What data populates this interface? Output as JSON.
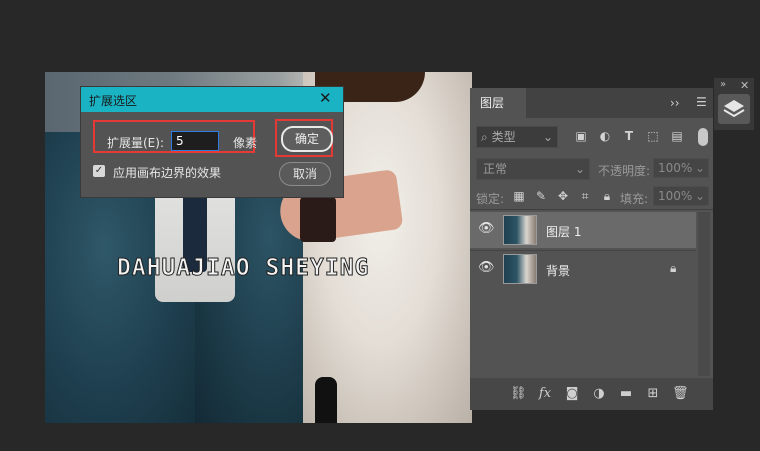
{
  "canvas": {
    "watermark_text": "DAHUAJIAO SHEYING"
  },
  "dialog": {
    "title": "扩展选区",
    "close_icon": "close-icon",
    "amount_label": "扩展量(E):",
    "amount_value": "5",
    "unit_label": "像素",
    "ok_label": "确定",
    "cancel_label": "取消",
    "checkbox_label": "应用画布边界的效果",
    "checkbox_checked": true,
    "accent_color": "#19b3c4",
    "highlight_color": "#e53935"
  },
  "layers_panel": {
    "tab_label": "图层",
    "collapse_icon": "double-chevron-right-icon",
    "menu_icon": "hamburger-menu-icon",
    "filter_kind_label": "类型",
    "filter_icons": [
      "image-filter-icon",
      "adjustment-filter-icon",
      "type-filter-icon",
      "shape-filter-icon",
      "smart-object-filter-icon"
    ],
    "blend_mode": "正常",
    "opacity_label": "不透明度:",
    "opacity_value": "100%",
    "lock_label": "锁定:",
    "lock_icons": [
      "lock-transparent-icon",
      "lock-pixels-icon",
      "lock-position-icon",
      "lock-artboard-icon",
      "lock-all-icon"
    ],
    "fill_label": "填充:",
    "fill_value": "100%",
    "layers": [
      {
        "name": "图层 1",
        "visible": true,
        "selected": true,
        "locked": false
      },
      {
        "name": "背景",
        "visible": true,
        "selected": false,
        "locked": true
      }
    ],
    "bottom_icons": [
      "link-layers-icon",
      "fx-icon",
      "add-mask-icon",
      "adjustment-layer-icon",
      "new-group-icon",
      "new-layer-icon",
      "delete-layer-icon"
    ]
  },
  "dock": {
    "expand_icon": "double-chevron-right-icon",
    "close_icon": "close-icon",
    "layers_icon": "layers-stack-icon"
  }
}
